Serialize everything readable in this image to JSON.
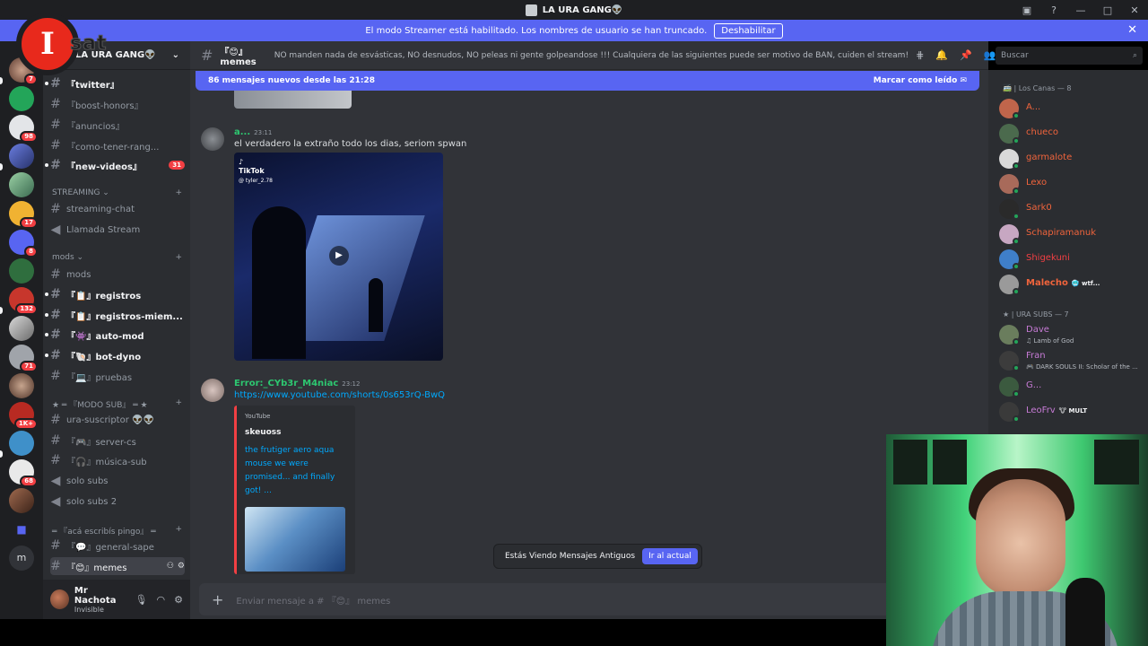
{
  "titlebar": {
    "title": "LA URA GANG👽",
    "icons": [
      "inbox-icon",
      "help-icon",
      "minimize-icon",
      "maximize-icon",
      "close-icon"
    ]
  },
  "banner": {
    "text": "El modo Streamer está habilitado. Los nombres de usuario se han truncado.",
    "button": "Deshabilitar"
  },
  "logo": {
    "letter": "I",
    "text": "sat"
  },
  "servers": [
    {
      "badge": "7"
    },
    {
      "badge": ""
    },
    {
      "badge": "98"
    },
    {
      "badge": ""
    },
    {
      "badge": ""
    },
    {
      "badge": "17"
    },
    {
      "badge": "8"
    },
    {
      "badge": ""
    },
    {
      "badge": "132"
    },
    {
      "badge": ""
    },
    {
      "badge": "71"
    },
    {
      "badge": ""
    },
    {
      "badge": "1K+"
    },
    {
      "badge": ""
    },
    {
      "badge": "68"
    },
    {
      "badge": ""
    }
  ],
  "guild": {
    "name": "LA URA GANG👽"
  },
  "channels": {
    "twitter": "『twitter』",
    "boost": "『boost-honors』",
    "anuncios": "『anuncios』",
    "como_tener": "『como-tener-rang...",
    "new_videos": "『new-videos』",
    "new_videos_badge": "31",
    "cat_streaming": "STREAMING ⌄",
    "streaming_chat": "streaming-chat",
    "llamada": "Llamada Stream",
    "cat_mods": "mods ⌄",
    "mods": "mods",
    "registros": "『📋』registros",
    "registros_miem": "『📋』registros-miem...",
    "automod": "『👾』auto-mod",
    "botdyno": "『🐚』bot-dyno",
    "pruebas": "『💻』pruebas",
    "cat_modo_sub": "★ ═ 『MODO SUB』 ═ ★",
    "ura_suscriptor": "ura-suscriptor 👽👽",
    "server_cs": "『🎮』server-cs",
    "musica_sub": "『🎧』música-sub",
    "solo_subs": "solo subs",
    "solo_subs2": "solo subs 2",
    "cat_aca": "═ 『acá escribís pingo』 ═",
    "general_sape": "『💬』general-sape",
    "memes": "『😊』memes"
  },
  "user": {
    "name": "Mr Nachota",
    "status": "Invisible"
  },
  "channel_header": {
    "name": "『😊』memes",
    "topic": "NO manden nada de esvásticas, NO desnudos, NO peleas ni gente golpeandose !!! Cualquiera de las siguientes puede ser motivo de BAN, cuiden el stream!"
  },
  "new_messages": {
    "text": "86 mensajes nuevos desde las 21:28",
    "action": "Marcar como leído"
  },
  "messages": [
    {
      "author": "a...",
      "time": "23:11",
      "text": "el verdadero la extraño todo los dias, seriom spwan",
      "video": {
        "brand": "TikTok",
        "user": "@ tyler_2.78"
      }
    },
    {
      "author": "Error:_CYb3r_M4niac",
      "time": "23:12",
      "link": "https://www.youtube.com/shorts/0s653rQ-BwQ",
      "embed": {
        "provider": "YouTube",
        "title": "skeuoss",
        "description": "the frutiger aero aqua mouse we were promised... and finally got! ..."
      }
    }
  ],
  "old_messages": {
    "text": "Estás Viendo Mensajes Antiguos",
    "button": "Ir al actual"
  },
  "composer": {
    "placeholder": "Enviar mensaje a # 『😊』 memes"
  },
  "search": {
    "placeholder": "Buscar"
  },
  "members": {
    "group1": "🚎 | Los Canas — 8",
    "group2": "★ | URA SUBS — 7",
    "list1": [
      {
        "name": "A...",
        "color": "#f0643c"
      },
      {
        "name": "chueco",
        "color": "#f0643c"
      },
      {
        "name": "garmalote",
        "color": "#f0643c"
      },
      {
        "name": "Lexo",
        "color": "#f0643c"
      },
      {
        "name": "Sark0",
        "color": "#f0643c"
      },
      {
        "name": "Schapiramanuk",
        "color": "#f0643c"
      },
      {
        "name": "Shigekuni",
        "color": "#f23f43"
      },
      {
        "name": "Malecho",
        "color": "#f0643c",
        "tag": "🥶 wtf..."
      }
    ],
    "list2": [
      {
        "name": "Dave",
        "color": "#c77bd6",
        "activity": "♫ Lamb of God"
      },
      {
        "name": "Fran",
        "color": "#c77bd6",
        "activity": "🎮 DARK SOULS II: Scholar of the ..."
      },
      {
        "name": "G...",
        "color": "#c77bd6",
        "activity": ""
      },
      {
        "name": "LeoFrv",
        "color": "#c77bd6",
        "tag": "🐮 MULT"
      }
    ]
  }
}
